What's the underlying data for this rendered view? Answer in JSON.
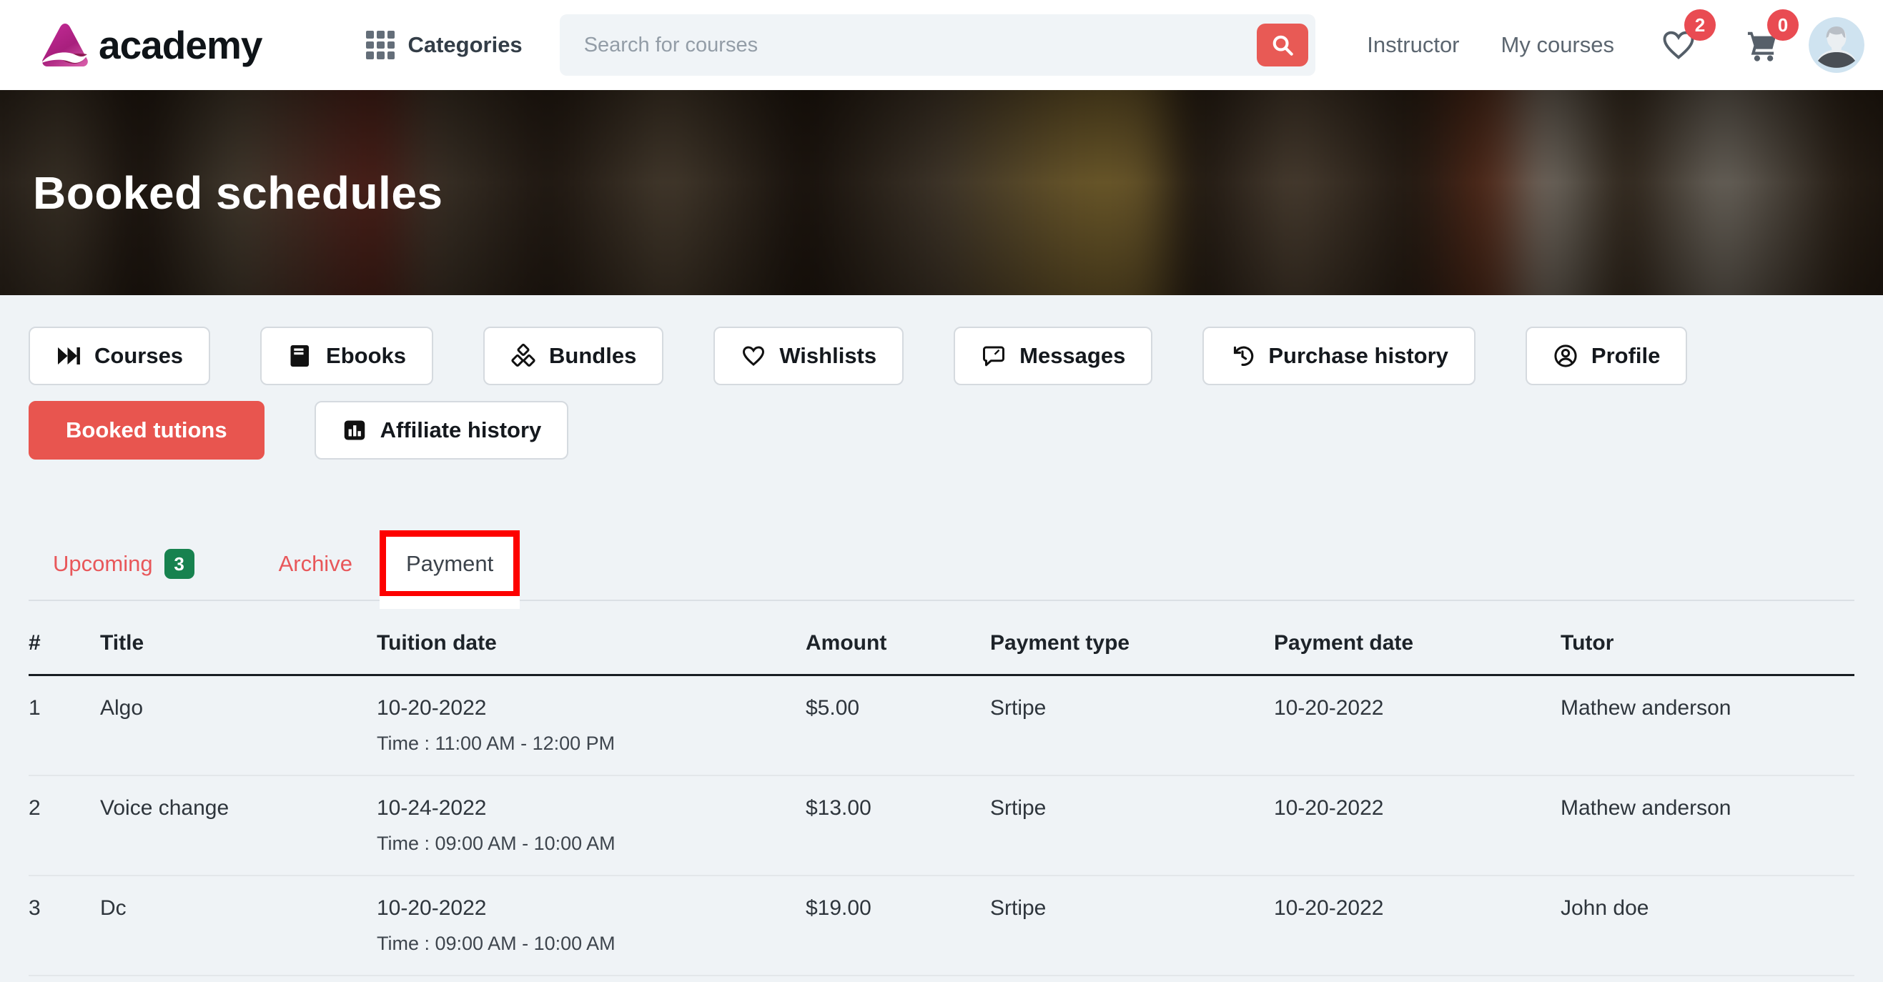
{
  "topbar": {
    "brand": "academy",
    "categories_label": "Categories",
    "search_placeholder": "Search for courses",
    "instructor_label": "Instructor",
    "my_courses_label": "My courses",
    "wishlist_count": "2",
    "cart_count": "0"
  },
  "hero": {
    "title": "Booked schedules"
  },
  "menu": {
    "row1": [
      {
        "label": "Courses"
      },
      {
        "label": "Ebooks"
      },
      {
        "label": "Bundles"
      },
      {
        "label": "Wishlists"
      },
      {
        "label": "Messages"
      },
      {
        "label": "Purchase history"
      },
      {
        "label": "Profile"
      }
    ],
    "row2": [
      {
        "label": "Booked tutions",
        "active": true
      },
      {
        "label": "Affiliate history"
      }
    ]
  },
  "tabs": {
    "upcoming": "Upcoming",
    "upcoming_badge": "3",
    "archive": "Archive",
    "payment": "Payment"
  },
  "table": {
    "columns": [
      "#",
      "Title",
      "Tuition date",
      "Amount",
      "Payment type",
      "Payment date",
      "Tutor"
    ],
    "rows": [
      {
        "index": "1",
        "title": "Algo",
        "tuition_date": "10-20-2022",
        "time": "Time : 11:00 AM - 12:00 PM",
        "amount": "$5.00",
        "payment_type": "Srtipe",
        "payment_date": "10-20-2022",
        "tutor": "Mathew anderson"
      },
      {
        "index": "2",
        "title": "Voice change",
        "tuition_date": "10-24-2022",
        "time": "Time : 09:00 AM - 10:00 AM",
        "amount": "$13.00",
        "payment_type": "Srtipe",
        "payment_date": "10-20-2022",
        "tutor": "Mathew anderson"
      },
      {
        "index": "3",
        "title": "Dc",
        "tuition_date": "10-20-2022",
        "time": "Time : 09:00 AM - 10:00 AM",
        "amount": "$19.00",
        "payment_type": "Srtipe",
        "payment_date": "10-20-2022",
        "tutor": "John doe"
      }
    ]
  },
  "colors": {
    "accent_red": "#e8554f",
    "badge_green": "#17824f",
    "annotation_red": "#fd0100",
    "page_background": "#eff3f6"
  }
}
